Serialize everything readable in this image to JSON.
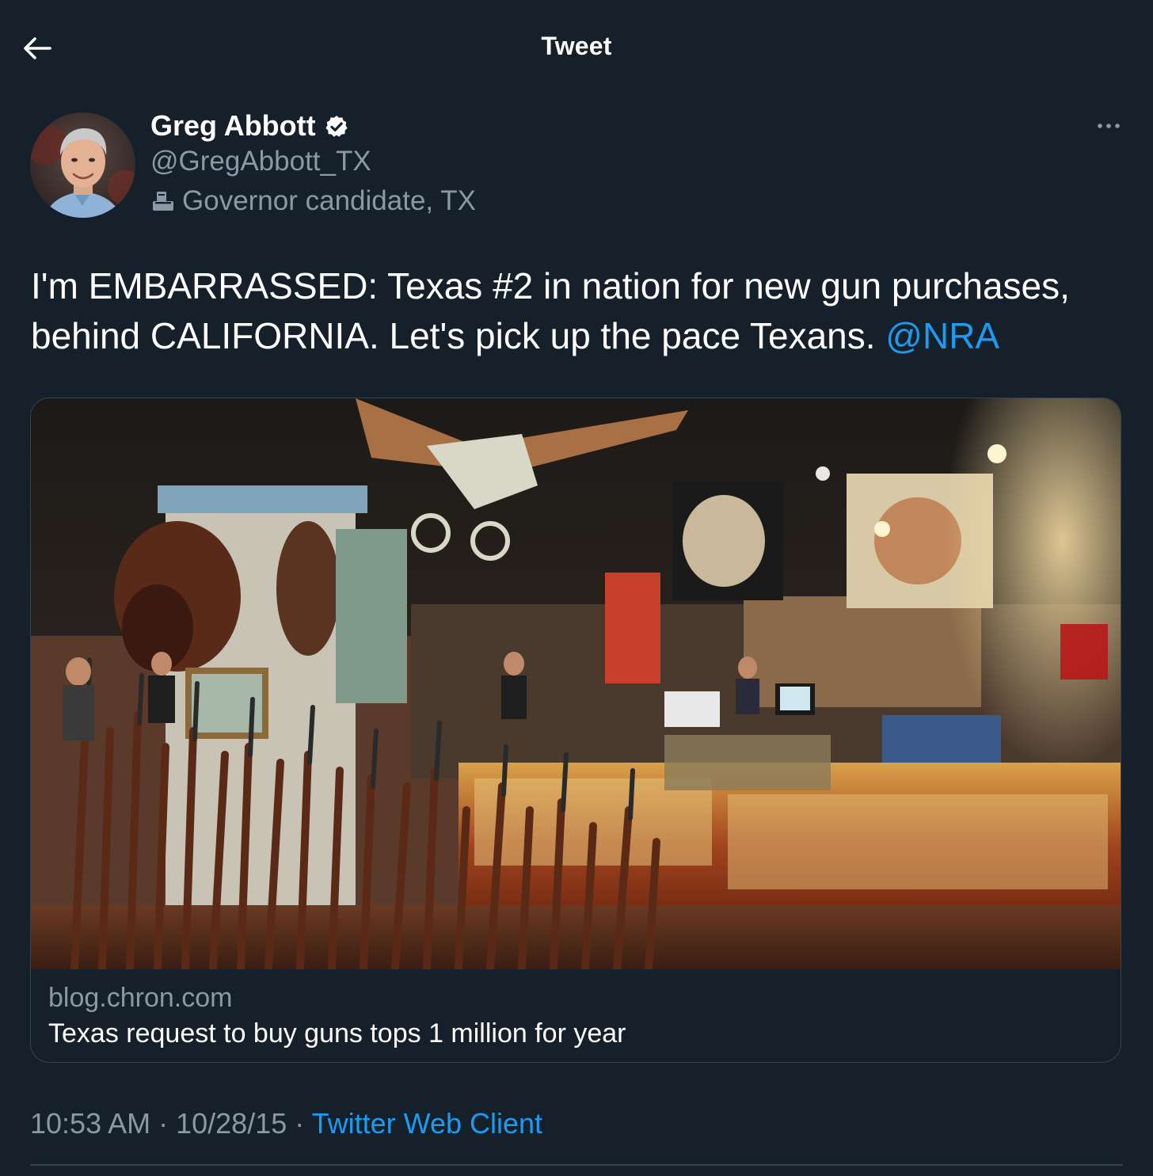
{
  "header": {
    "title": "Tweet",
    "back_icon": "arrow-left-icon"
  },
  "tweet": {
    "author_name": "Greg Abbott",
    "verified_icon": "verified-badge-icon",
    "handle": "@GregAbbott_TX",
    "label_icon": "ballot-box-icon",
    "label": "Governor candidate, TX",
    "more_icon": "more-horizontal-icon",
    "text_before_mention": "I'm EMBARRASSED: Texas #2 in nation for new gun purchases, behind CALIFORNIA. Let's pick up the pace Texans. ",
    "mention": "@NRA",
    "card": {
      "domain": "blog.chron.com",
      "title": "Texas request to buy guns tops 1 million for year"
    },
    "time": "10:53 AM",
    "separator": " · ",
    "date": "10/28/15",
    "source": "Twitter Web Client"
  },
  "colors": {
    "background": "#15202b",
    "text_primary": "#ffffff",
    "text_secondary": "#8b98a5",
    "link": "#1d9bf0",
    "border": "#38444d"
  }
}
